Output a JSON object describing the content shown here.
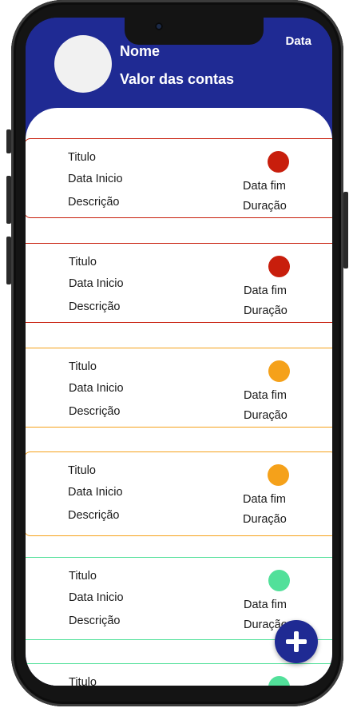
{
  "header": {
    "name": "Nome",
    "total_label": "Valor das contas",
    "date": "Data"
  },
  "colors": {
    "brand": "#1f2a93",
    "status_red": "#c81e0c",
    "status_orange": "#f5a11a",
    "status_green": "#52e09a"
  },
  "cards": [
    {
      "title": "Titulo",
      "start": "Data Inicio",
      "description": "Descrição",
      "end": "Data fim",
      "duration": "Duração",
      "status_color": "#c81e0c"
    },
    {
      "title": "Titulo",
      "start": "Data Inicio",
      "description": "Descrição",
      "end": "Data fim",
      "duration": "Duração",
      "status_color": "#c81e0c"
    },
    {
      "title": "Titulo",
      "start": "Data Inicio",
      "description": "Descrição",
      "end": "Data fim",
      "duration": "Duração",
      "status_color": "#f5a11a"
    },
    {
      "title": "Titulo",
      "start": "Data Inicio",
      "description": "Descrição",
      "end": "Data fim",
      "duration": "Duração",
      "status_color": "#f5a11a"
    },
    {
      "title": "Titulo",
      "start": "Data Inicio",
      "description": "Descrição",
      "end": "Data fim",
      "duration": "Duração",
      "status_color": "#52e09a"
    },
    {
      "title": "Titulo",
      "start": "",
      "description": "",
      "end": "",
      "duration": "",
      "status_color": "#52e09a"
    }
  ],
  "fab": {
    "icon": "plus-icon"
  }
}
